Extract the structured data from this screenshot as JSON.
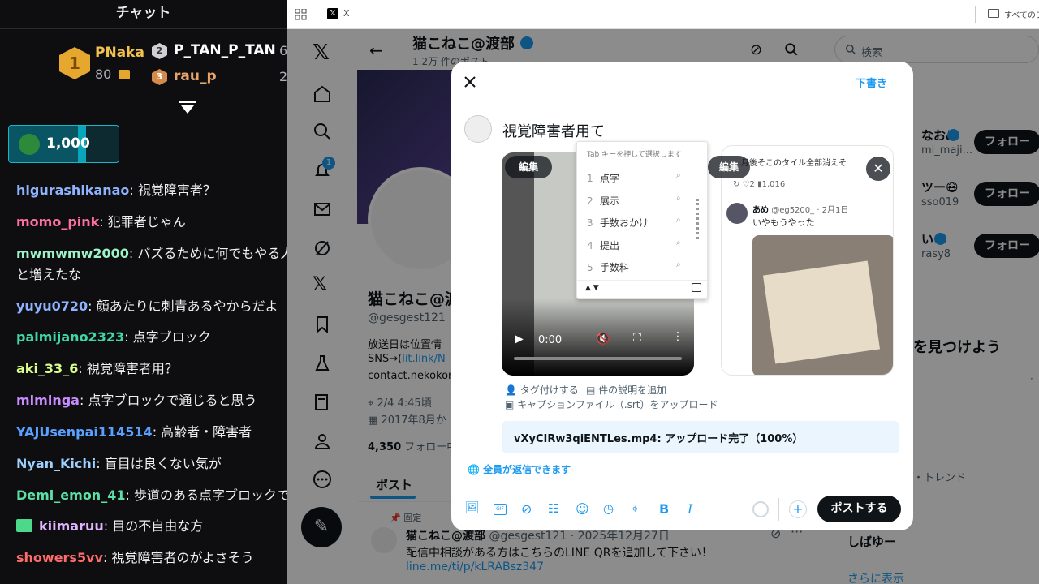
{
  "chat": {
    "title": "チャット",
    "leaderboard": [
      {
        "rank": "1",
        "name": "PNaka",
        "points": "80",
        "partial": "6"
      },
      {
        "rank": "2",
        "name": "P_TAN_P_TAN",
        "partial": "2"
      },
      {
        "rank": "3",
        "name": "rau_p"
      }
    ],
    "gift_amount": "1,000",
    "messages": [
      {
        "user": "higurashikanao",
        "text": "視覚障害者？",
        "color": "#8fb4ff"
      },
      {
        "user": "momo_pink",
        "text": "犯罪者じゃん",
        "color": "#ff6fa1"
      },
      {
        "user": "mwmwmw2000",
        "text": "バズるために何でもやる人",
        "text2": "と増えたな",
        "color": "#9ef2c7"
      },
      {
        "user": "yuyu0720",
        "text": "顔あたりに刺青あるやからだよ",
        "color": "#8fb4ff"
      },
      {
        "user": "palmijano2323",
        "text": "点字ブロック",
        "color": "#3fd6a6"
      },
      {
        "user": "aki_33_6",
        "text": "視覚障害者用？",
        "color": "#d8ff8a"
      },
      {
        "user": "miminga",
        "text": "点字ブロックで通じると思う",
        "color": "#c78cff"
      },
      {
        "user": "YAJUsenpai114514",
        "text": "高齢者・障害者",
        "color": "#5aa0ff"
      },
      {
        "user": "Nyan_Kichi",
        "text": "盲目は良くない気が",
        "color": "#9ed0ff"
      },
      {
        "user": "Demi_emon_41",
        "text": "歩道のある点字ブロックで",
        "color": "#5ce0a6"
      },
      {
        "user": "kiimaruu",
        "text": "目の不自由な方",
        "color": "#e0b3ff"
      },
      {
        "user": "showers5vv",
        "text": "視覚障害者のがよさそう",
        "color": "#ff6b6b"
      }
    ]
  },
  "browser": {
    "tab_title": "X",
    "bookmarks_label": "すべてのブ"
  },
  "profile": {
    "name": "猫こねこ@渡部",
    "post_count": "1.2万 件のポスト",
    "display_name_partial": "猫こねこ@渡",
    "handle": "@gesgest121",
    "bio1": "放送日は位置情",
    "bio2_prefix": "SNS→(",
    "bio2_link": "lit.link/N",
    "bio3": "contact.nekokon",
    "location": "2/4 4:45頃",
    "joined": "2017年8月か",
    "followers": "4,350",
    "followers_label": "フォロー中",
    "tab_posts": "ポスト",
    "pinned_label": "固定",
    "pinned_name": "猫こねこ@渡部",
    "pinned_meta": "@gesgest121 · 2025年12月27日",
    "pinned_text": "配信中相談がある方はこちらのLINE QRを追加して下さい！",
    "pinned_link": "line.me/ti/p/kLRABsz347",
    "notification_count": "1"
  },
  "right": {
    "search_placeholder": "検索",
    "suggestions": [
      {
        "name": "なおみ",
        "handle": "mi_maji..."
      },
      {
        "name": "ツー😷",
        "handle": "sso019"
      },
      {
        "name": "い",
        "handle": "rasy8"
      }
    ],
    "follow_label": "フォロー",
    "find_title": "を見つけよう",
    "trend_label": "・トレンド",
    "trend_item": "しばゆー",
    "show_more": "さらに表示"
  },
  "composer": {
    "draft_label": "下書き",
    "text": "視覚障害者用て",
    "edit_label": "編集",
    "ime_hint": "Tab キーを押して選択します",
    "candidates": [
      {
        "n": "1",
        "text": "点字"
      },
      {
        "n": "2",
        "text": "展示"
      },
      {
        "n": "3",
        "text": "手数おかけ"
      },
      {
        "n": "4",
        "text": "提出"
      },
      {
        "n": "5",
        "text": "手数料"
      }
    ],
    "video_time": "0:00",
    "quoted": {
      "top_partial": "…月後そこのタイル全部消えそ",
      "stat_likes": "2",
      "stat_views": "1,016",
      "author": "あめ",
      "author_meta": "@eg5200_ · 2月1日",
      "text": "いやもうやった"
    },
    "tag_people": "タグ付けする",
    "add_description": "件の説明を追加",
    "caption_upload": "キャプションファイル（.srt）をアップロード",
    "upload_status": "vXyCIRw3qiENTLes.mp4: アップロード完了（100%）",
    "reply_setting": "全員が返信できます",
    "post_button": "ポストする"
  }
}
